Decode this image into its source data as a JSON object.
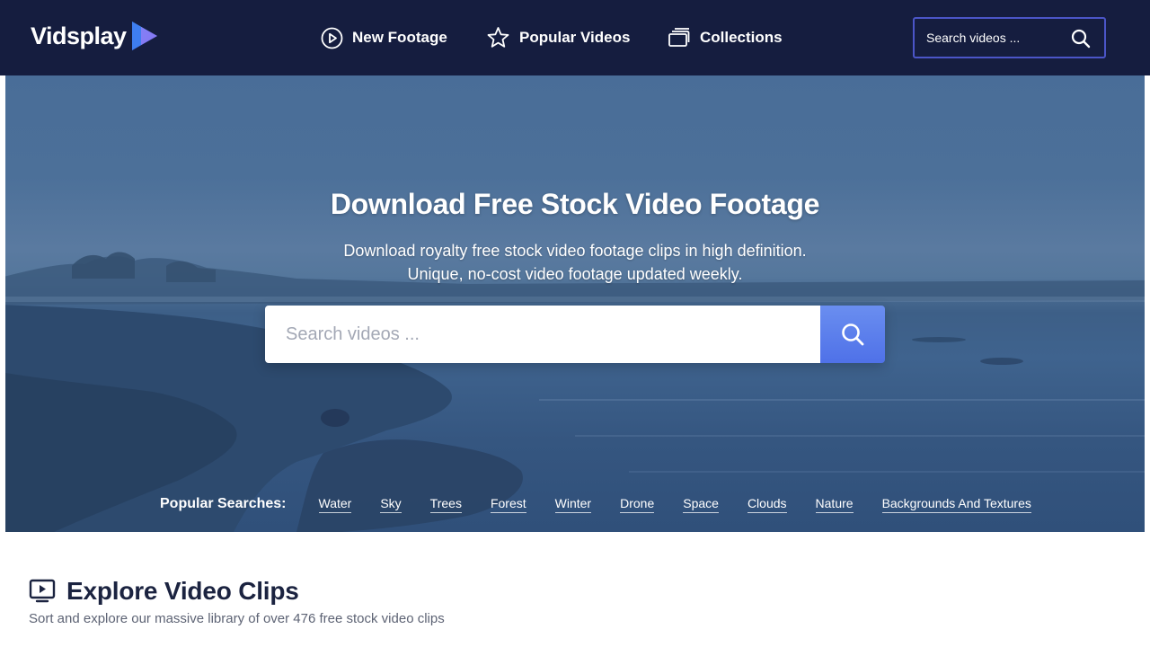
{
  "brand": {
    "name": "Vidsplay",
    "icon": "play-logo-icon",
    "accent": "#4f71e8"
  },
  "nav": [
    {
      "label": "New Footage",
      "icon": "play-circle-icon"
    },
    {
      "label": "Popular Videos",
      "icon": "star-icon"
    },
    {
      "label": "Collections",
      "icon": "collections-icon"
    }
  ],
  "header_search": {
    "placeholder": "Search videos ...",
    "icon": "search-icon"
  },
  "hero": {
    "title": "Download Free Stock Video Footage",
    "subtitle_line1": "Download royalty free stock video footage clips in high definition.",
    "subtitle_line2": "Unique, no-cost video footage updated weekly.",
    "search_placeholder": "Search videos ...",
    "search_icon": "search-icon"
  },
  "popular_searches": {
    "label": "Popular Searches:",
    "tags": [
      "Water",
      "Sky",
      "Trees",
      "Forest",
      "Winter",
      "Drone",
      "Space",
      "Clouds",
      "Nature",
      "Backgrounds And Textures"
    ]
  },
  "explore": {
    "title": "Explore Video Clips",
    "description": "Sort and explore our massive library of over 476 free stock video clips",
    "icon": "video-monitor-icon"
  },
  "colors": {
    "header_bg": "#151d3f",
    "search_border": "#4b55c7",
    "hero_overlay": "#3f638e",
    "search_button": "#5a7fec"
  }
}
